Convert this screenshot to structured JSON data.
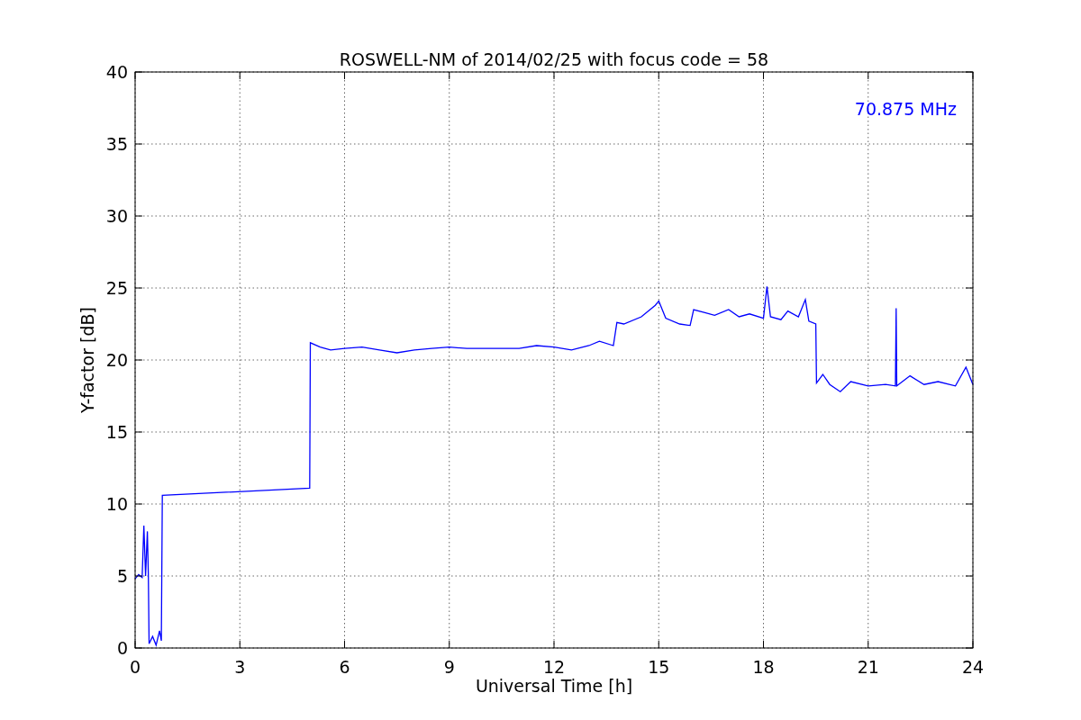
{
  "chart_data": {
    "type": "line",
    "title": "ROSWELL-NM of 2014/02/25 with focus code = 58",
    "xlabel": "Universal Time [h]",
    "ylabel": "Y-factor [dB]",
    "x": [
      0,
      0.1,
      0.2,
      0.25,
      0.3,
      0.35,
      0.38,
      0.4,
      0.5,
      0.6,
      0.7,
      0.75,
      0.78,
      5.0,
      5.02,
      5.3,
      5.6,
      6,
      6.5,
      7,
      7.5,
      8,
      8.5,
      9,
      9.5,
      10,
      11,
      11.5,
      12,
      12.5,
      13,
      13.3,
      13.7,
      13.8,
      14,
      14.5,
      14.9,
      15,
      15.2,
      15.6,
      15.9,
      16,
      16.3,
      16.6,
      17,
      17.3,
      17.6,
      18,
      18.1,
      18.2,
      18.5,
      18.7,
      19,
      19.2,
      19.3,
      19.5,
      19.52,
      19.7,
      19.9,
      20.2,
      20.5,
      21,
      21.5,
      21.78,
      21.8,
      21.82,
      22.2,
      22.6,
      23,
      23.5,
      23.8,
      24
    ],
    "series": [
      {
        "name": "70.875 MHz",
        "color": "#0000ff",
        "values": [
          4.8,
          5.1,
          4.9,
          8.5,
          5.0,
          8.1,
          5.0,
          0.3,
          0.8,
          0.2,
          1.2,
          0.5,
          10.6,
          11.1,
          21.2,
          20.9,
          20.7,
          20.8,
          20.9,
          20.7,
          20.5,
          20.7,
          20.8,
          20.9,
          20.8,
          20.8,
          20.8,
          21.0,
          20.9,
          20.7,
          21.0,
          21.3,
          21.0,
          22.6,
          22.5,
          23.0,
          23.8,
          24.1,
          22.9,
          22.5,
          22.4,
          23.5,
          23.3,
          23.1,
          23.5,
          23.0,
          23.2,
          22.9,
          25.1,
          23.0,
          22.8,
          23.4,
          23.0,
          24.2,
          22.7,
          22.5,
          18.4,
          19.0,
          18.3,
          17.8,
          18.5,
          18.2,
          18.3,
          18.2,
          23.6,
          18.2,
          18.9,
          18.3,
          18.5,
          18.2,
          19.5,
          18.3
        ]
      }
    ],
    "xlim": [
      0,
      24
    ],
    "ylim": [
      0,
      40
    ],
    "xticks": [
      0,
      3,
      6,
      9,
      12,
      15,
      18,
      21,
      24
    ],
    "yticks": [
      0,
      5,
      10,
      15,
      20,
      25,
      30,
      35,
      40
    ],
    "grid": true
  }
}
